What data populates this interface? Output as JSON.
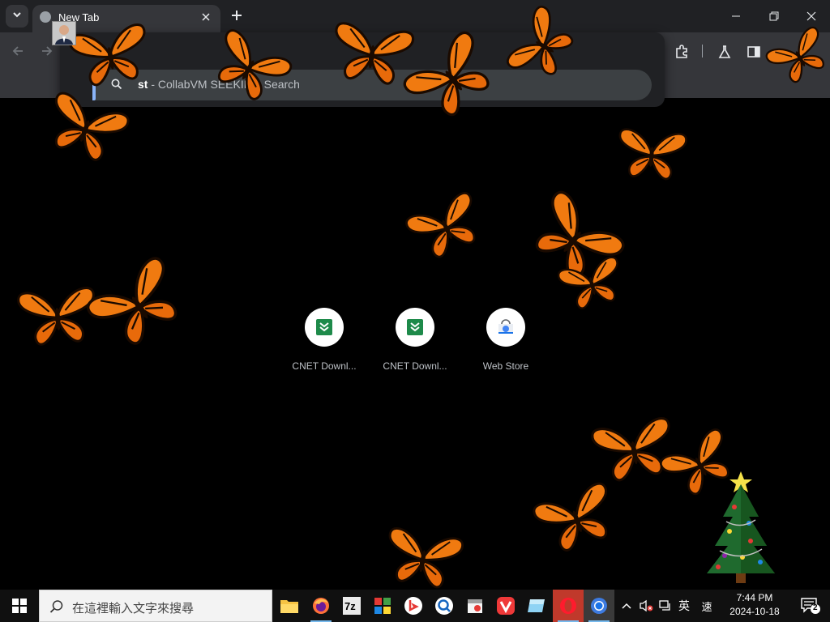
{
  "browser": {
    "tab": {
      "title": "New Tab"
    },
    "omnibox": {
      "suggestion_query": "st",
      "suggestion_rest": " - CollabVM SEEKING Search"
    }
  },
  "ntp": {
    "shortcuts": [
      {
        "label": "CNET Downl...",
        "icon": "cnet-download-icon"
      },
      {
        "label": "CNET Downl...",
        "icon": "cnet-download-icon"
      },
      {
        "label": "Web Store",
        "icon": "web-store-icon"
      }
    ]
  },
  "taskbar": {
    "search_placeholder": "在這裡輸入文字來搜尋",
    "apps": [
      "file-explorer-icon",
      "firefox-icon",
      "7zip-icon",
      "app-icon",
      "bing-icon",
      "search-app-icon",
      "calendar-app-icon",
      "vivaldi-icon",
      "notes-app-icon",
      "opera-icon",
      "chrome-icon"
    ],
    "ime_lang": "英",
    "ime_mode": "速",
    "time": "7:44 PM",
    "date": "2024-10-18",
    "notification_count": "2"
  },
  "colors": {
    "accent": "#8ab4f8",
    "toolbar_bg": "#35363a",
    "tab_strip_bg": "#202124",
    "butterfly_orange": "#f07a10"
  }
}
